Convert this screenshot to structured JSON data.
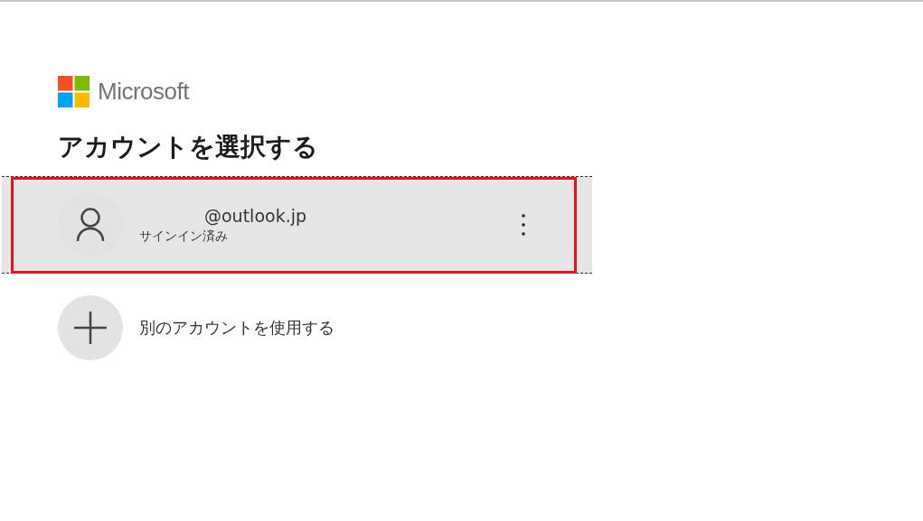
{
  "logo": {
    "text": "Microsoft"
  },
  "title": "アカウントを選択する",
  "accounts": [
    {
      "email": "@outlook.jp",
      "status": "サインイン済み",
      "highlighted": true
    }
  ],
  "add_account": {
    "label": "別のアカウントを使用する"
  }
}
